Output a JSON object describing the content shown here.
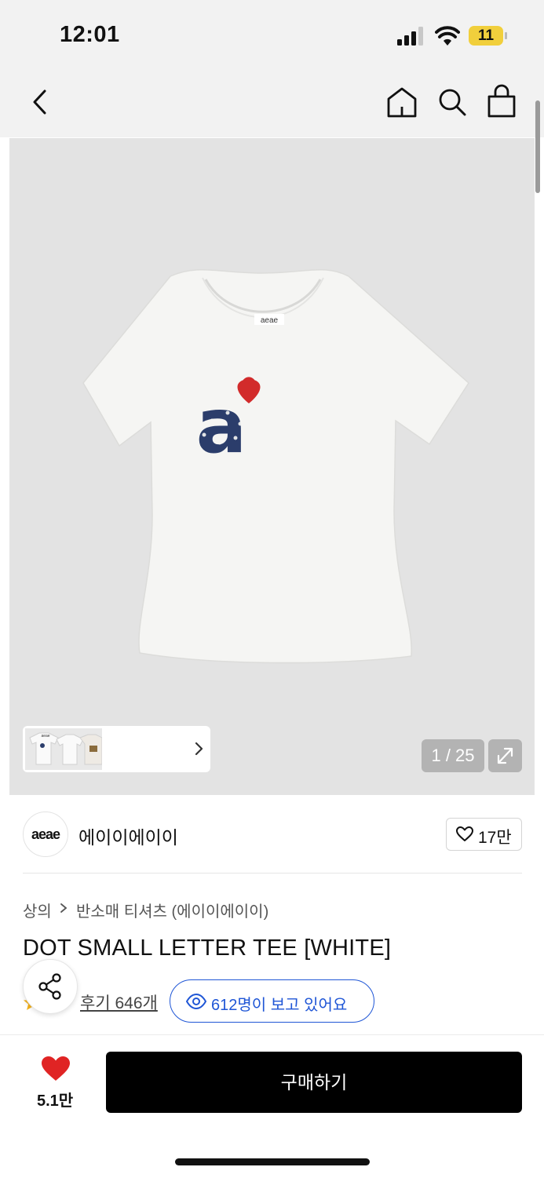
{
  "status_bar": {
    "time": "12:01",
    "battery_level": "11"
  },
  "gallery": {
    "counter": "1 / 25",
    "tee_print_letter": "a",
    "tee_neck_label": "aeae",
    "thumb_neck_label": "aeae"
  },
  "brand": {
    "logo_text": "aeae",
    "name": "에이이에이이",
    "like_count": "17만"
  },
  "breadcrumb": {
    "category": "상의",
    "subcategory": "반소매 티셔츠 (에이이에이이)"
  },
  "product": {
    "title": "DOT SMALL LETTER TEE [WHITE]"
  },
  "rating": {
    "review_link": "후기 646개",
    "viewers": "612명이 보고 있어요"
  },
  "bottom_bar": {
    "wish_count": "5.1만",
    "buy_label": "구매하기"
  },
  "colors": {
    "accent_blue": "#1f56d6",
    "heart_red": "#e02424",
    "print_navy": "#2b3d6b",
    "battery_yellow": "#f1cf3c",
    "buy_black": "#000000"
  }
}
